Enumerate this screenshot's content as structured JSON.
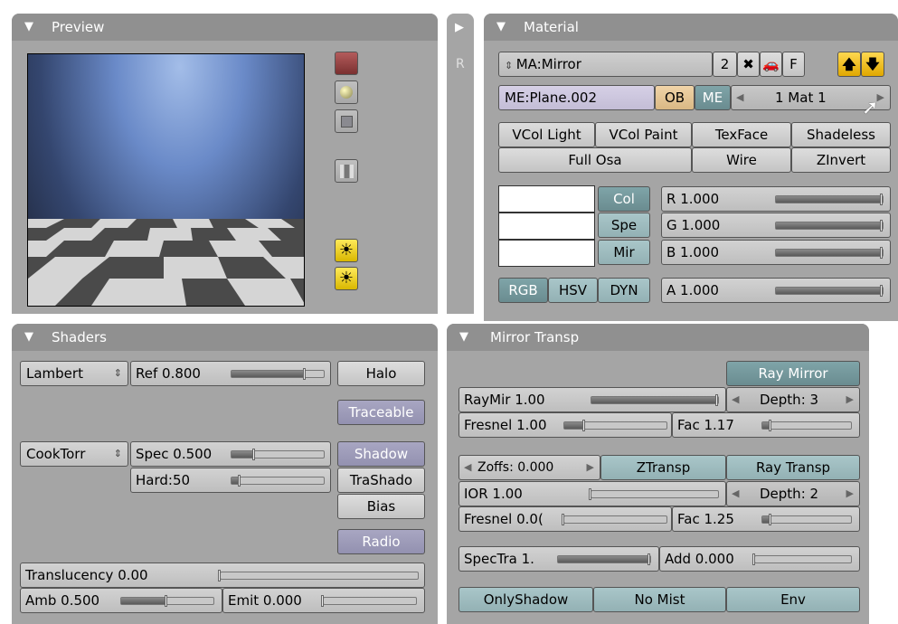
{
  "preview": {
    "title": "Preview"
  },
  "material": {
    "title": "Material",
    "r_label": "R",
    "name": "MA:Mirror",
    "users": "2",
    "fake": "F",
    "mesh": "ME:Plane.002",
    "ob": "OB",
    "me": "ME",
    "mat_index": "1 Mat 1",
    "row1": [
      "VCol Light",
      "VCol Paint",
      "TexFace",
      "Shadeless"
    ],
    "row2": [
      "Full Osa",
      "Wire",
      "ZInvert"
    ],
    "col_tabs": [
      "Col",
      "Spe",
      "Mir"
    ],
    "sliders": [
      {
        "label": "R 1.000",
        "value": 1.0
      },
      {
        "label": "G 1.000",
        "value": 1.0
      },
      {
        "label": "B 1.000",
        "value": 1.0
      }
    ],
    "modes": [
      "RGB",
      "HSV",
      "DYN"
    ],
    "alpha": {
      "label": "A 1.000",
      "value": 1.0
    }
  },
  "shaders": {
    "title": "Shaders",
    "diffuse": "Lambert",
    "ref": {
      "label": "Ref  0.800",
      "value": 0.8
    },
    "halo": "Halo",
    "traceable": "Traceable",
    "spec_shader": "CookTorr",
    "spec": {
      "label": "Spec 0.500",
      "value": 0.25
    },
    "hard": {
      "label": "Hard:50",
      "value": 0.1
    },
    "shadow": "Shadow",
    "trashado": "TraShado",
    "bias": "Bias",
    "radio": "Radio",
    "translucency": {
      "label": "Translucency 0.00",
      "value": 0.0
    },
    "amb": {
      "label": "Amb 0.500",
      "value": 0.5
    },
    "emit": {
      "label": "Emit 0.000",
      "value": 0.0
    }
  },
  "mirror": {
    "title": "Mirror Transp",
    "ray_mirror": "Ray Mirror",
    "raymir": {
      "label": "RayMir 1.00",
      "value": 1.0
    },
    "depth1": "Depth: 3",
    "fresnel1": {
      "label": "Fresnel 1.00",
      "value": 0.2
    },
    "fac1": {
      "label": "Fac 1.17",
      "value": 0.1
    },
    "zoffs": "Zoffs: 0.000",
    "ztransp": "ZTransp",
    "ray_transp": "Ray Transp",
    "ior": {
      "label": "IOR 1.00",
      "value": 0.0
    },
    "depth2": "Depth: 2",
    "fresnel2": {
      "label": "Fresnel 0.0(",
      "value": 0.0
    },
    "fac2": {
      "label": "Fac 1.25",
      "value": 0.1
    },
    "spectra": {
      "label": "SpecTra 1.",
      "value": 1.0
    },
    "add": {
      "label": "Add 0.000",
      "value": 0.0
    },
    "bottom": [
      "OnlyShadow",
      "No Mist",
      "Env"
    ]
  }
}
